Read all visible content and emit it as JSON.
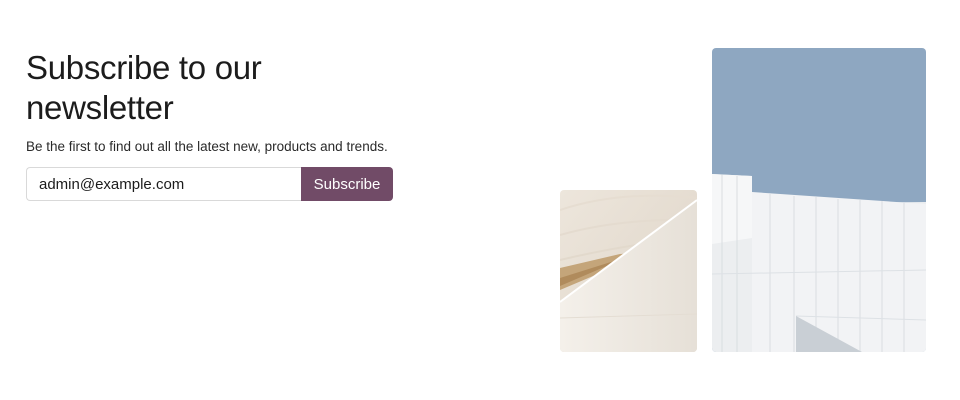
{
  "newsletter": {
    "title": "Subscribe to our newsletter",
    "subtitle": "Be the first to find out all the latest new, products and trends.",
    "email_value": "admin@example.com",
    "subscribe_label": "Subscribe"
  },
  "images": {
    "small": {
      "subject": "beige curved architectural walls with wooden accent"
    },
    "large": {
      "subject": "white paneled modern building against blue sky"
    }
  },
  "colors": {
    "accent": "#714b67",
    "sky": "#8ea7c1",
    "text": "#1c1c1c"
  }
}
